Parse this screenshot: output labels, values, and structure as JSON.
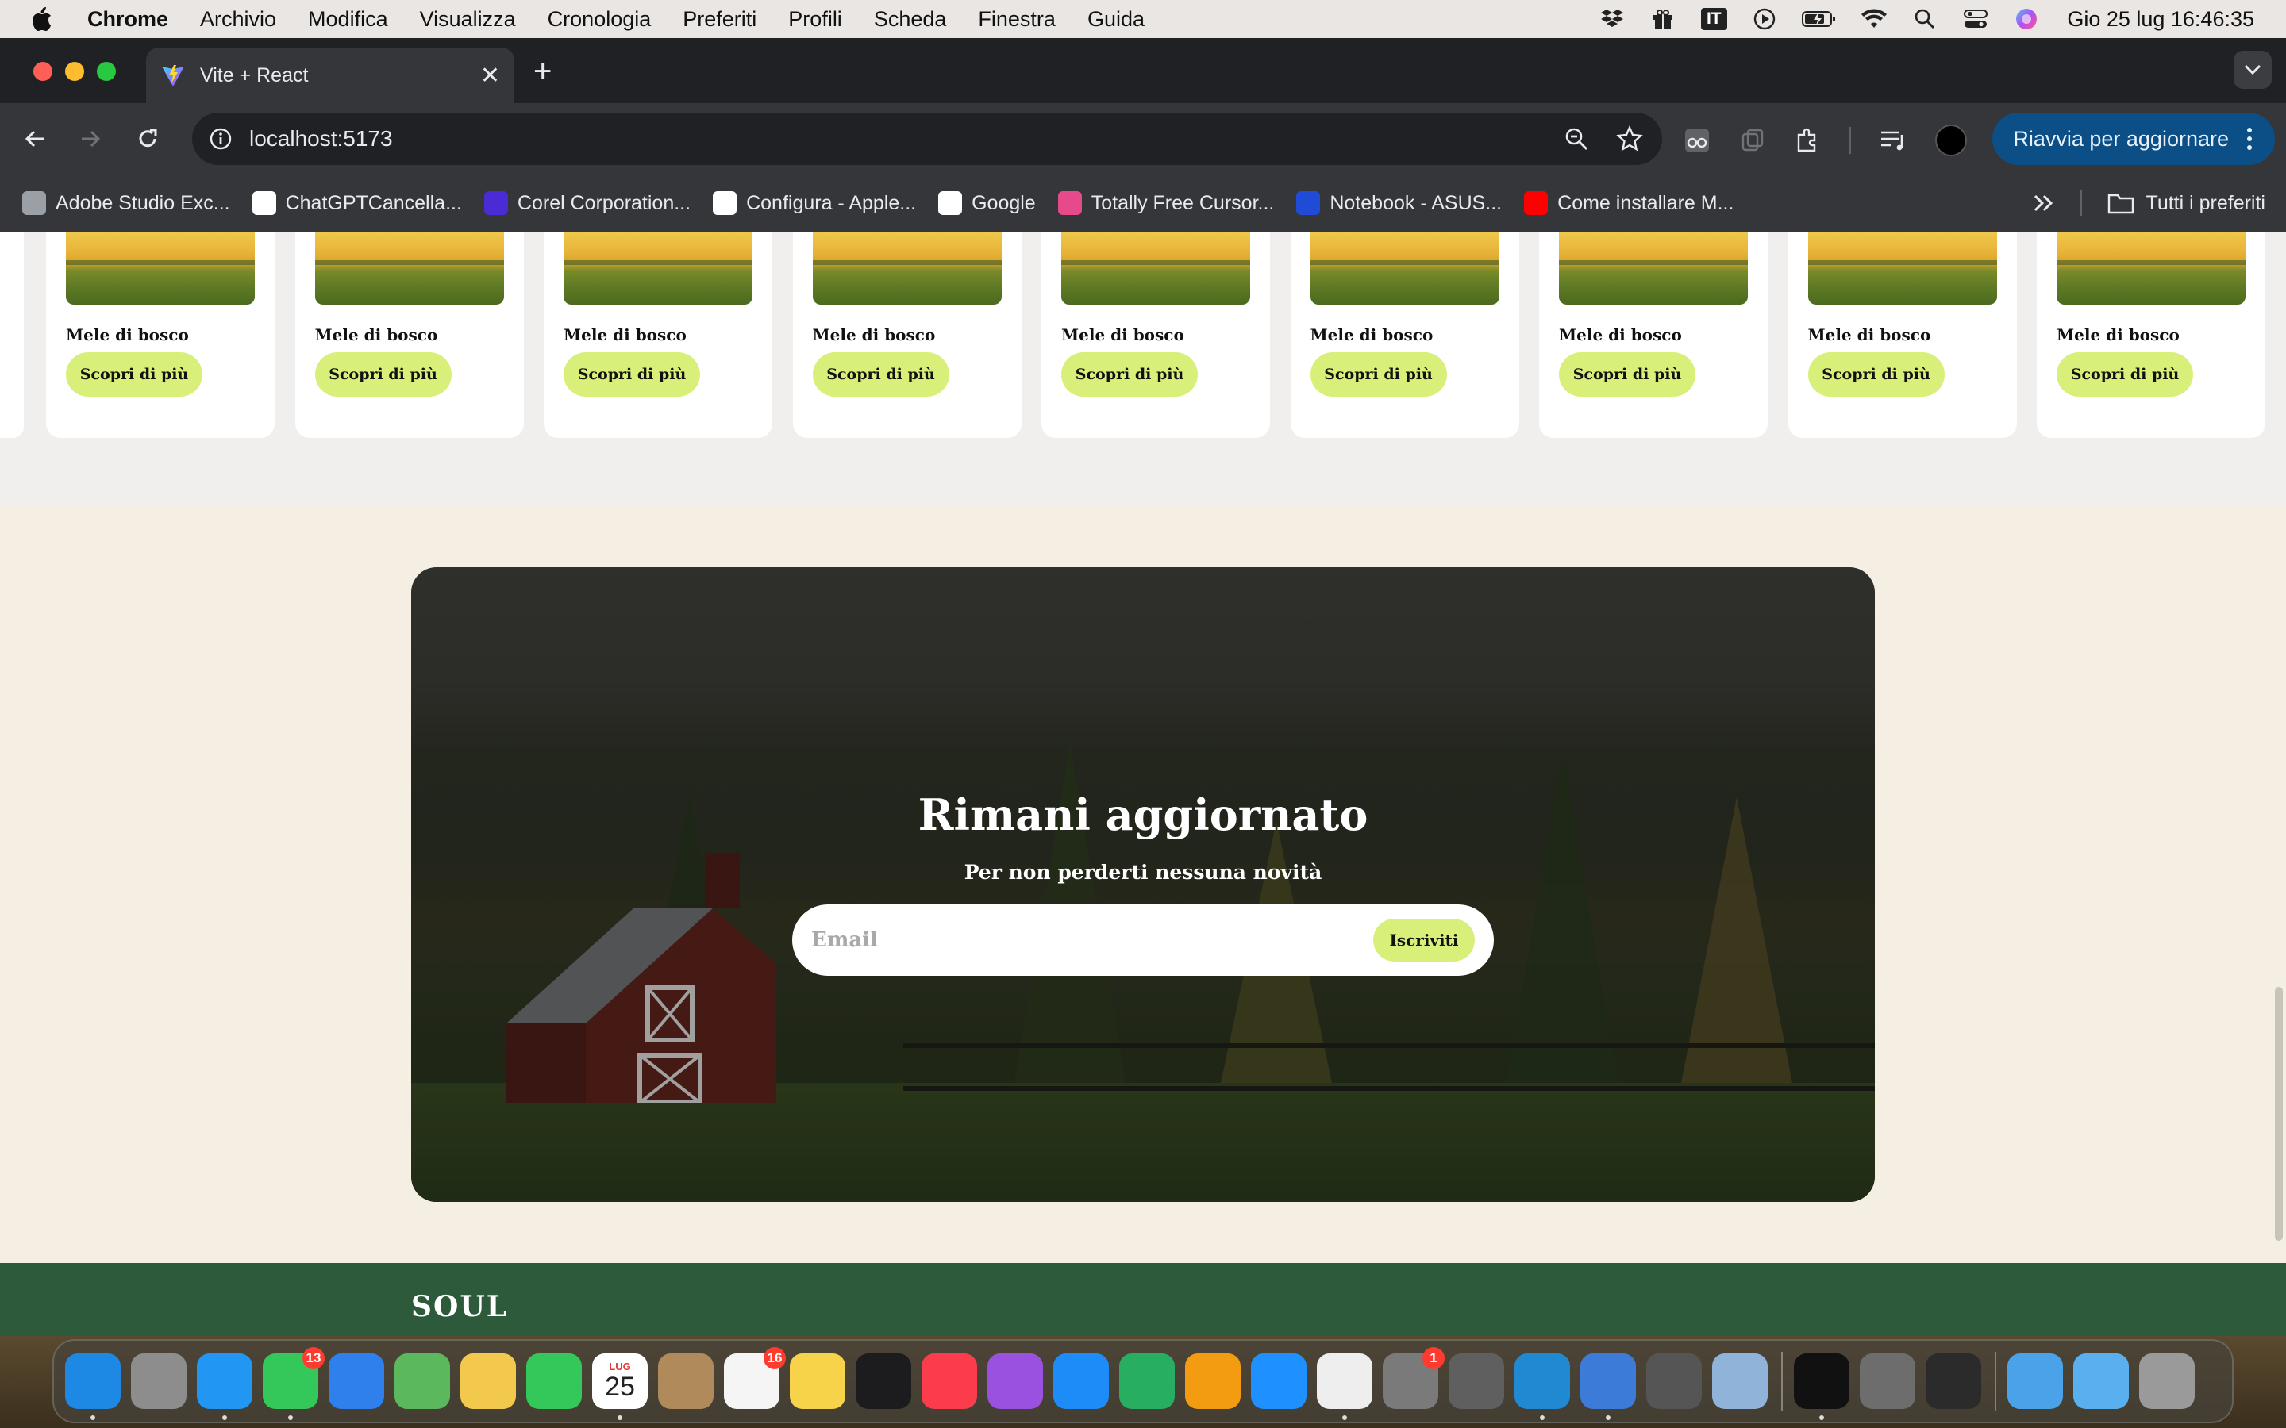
{
  "menubar": {
    "app": "Chrome",
    "items": [
      "Archivio",
      "Modifica",
      "Visualizza",
      "Cronologia",
      "Preferiti",
      "Profili",
      "Scheda",
      "Finestra",
      "Guida"
    ],
    "input_source": "IT",
    "clock": "Gio 25 lug  16:46:35"
  },
  "browser": {
    "tab_title": "Vite + React",
    "url": "localhost:5173",
    "update_button": "Riavvia per aggiornare",
    "bookmarks": [
      {
        "label": "Adobe Studio Exc...",
        "icon": "globe-icon",
        "color": "#9aa0a6"
      },
      {
        "label": "ChatGPTCancella...",
        "icon": "chatgpt-icon",
        "color": "#ffffff"
      },
      {
        "label": "Corel Corporation...",
        "icon": "corel-icon",
        "color": "#4b2bd6"
      },
      {
        "label": "Configura - Apple...",
        "icon": "apple-icon",
        "color": "#ffffff"
      },
      {
        "label": "Google",
        "icon": "google-icon",
        "color": "#ffffff"
      },
      {
        "label": "Totally Free Cursor...",
        "icon": "cursor-icon",
        "color": "#e64a8a"
      },
      {
        "label": "Notebook - ASUS...",
        "icon": "asus-icon",
        "color": "#1f4bd6"
      },
      {
        "label": "Come installare M...",
        "icon": "youtube-icon",
        "color": "#ff0000"
      }
    ],
    "all_bookmarks": "Tutti i preferiti"
  },
  "page": {
    "products": [
      {
        "name": "Mele di bosco",
        "cta": "Scopri di più"
      },
      {
        "name": "Mele di bosco",
        "cta": "Scopri di più"
      },
      {
        "name": "Mele di bosco",
        "cta": "Scopri di più"
      },
      {
        "name": "Mele di bosco",
        "cta": "Scopri di più"
      },
      {
        "name": "Mele di bosco",
        "cta": "Scopri di più"
      },
      {
        "name": "Mele di bosco",
        "cta": "Scopri di più"
      },
      {
        "name": "Mele di bosco",
        "cta": "Scopri di più"
      },
      {
        "name": "Mele di bosco",
        "cta": "Scopri di più"
      },
      {
        "name": "Mele di bosco",
        "cta": "Scopri di più"
      }
    ],
    "newsletter": {
      "title": "Rimani aggiornato",
      "subtitle": "Per non perderti nessuna novità",
      "email_placeholder": "Email",
      "submit": "Iscriviti"
    },
    "footer_logo": "SOUL"
  },
  "dock": {
    "calendar_month": "LUG",
    "calendar_day": "25",
    "apps": [
      {
        "name": "finder-icon",
        "color": "#1e88e5",
        "badge": ""
      },
      {
        "name": "launchpad-icon",
        "color": "#8d8d8d",
        "badge": ""
      },
      {
        "name": "safari-icon",
        "color": "#2196f3",
        "badge": ""
      },
      {
        "name": "messages-icon",
        "color": "#34c759",
        "badge": "13"
      },
      {
        "name": "mail-icon",
        "color": "#2f80ed",
        "badge": ""
      },
      {
        "name": "maps-icon",
        "color": "#5cb85c",
        "badge": ""
      },
      {
        "name": "photos-icon",
        "color": "#f2c94c",
        "badge": ""
      },
      {
        "name": "facetime-icon",
        "color": "#34c759",
        "badge": ""
      },
      {
        "name": "calendar-icon",
        "color": "#ffffff",
        "badge": ""
      },
      {
        "name": "contacts-icon",
        "color": "#b08a5a",
        "badge": ""
      },
      {
        "name": "reminders-icon",
        "color": "#f5f5f5",
        "badge": "16"
      },
      {
        "name": "notes-icon",
        "color": "#f7d34a",
        "badge": ""
      },
      {
        "name": "tv-icon",
        "color": "#1c1c1e",
        "badge": ""
      },
      {
        "name": "music-icon",
        "color": "#fa3c4c",
        "badge": ""
      },
      {
        "name": "podcasts-icon",
        "color": "#9b51e0",
        "badge": ""
      },
      {
        "name": "keynote-icon",
        "color": "#1d8cf8",
        "badge": ""
      },
      {
        "name": "numbers-icon",
        "color": "#27ae60",
        "badge": ""
      },
      {
        "name": "pages-icon",
        "color": "#f39c12",
        "badge": ""
      },
      {
        "name": "app-store-icon",
        "color": "#1e90ff",
        "badge": ""
      },
      {
        "name": "chrome-icon",
        "color": "#eeeeee",
        "badge": ""
      },
      {
        "name": "system-settings-icon",
        "color": "#7a7a7a",
        "badge": "1"
      },
      {
        "name": "screenshot-icon",
        "color": "#5f5f5f",
        "badge": ""
      },
      {
        "name": "vscode-icon",
        "color": "#1f8ad2",
        "badge": ""
      },
      {
        "name": "lw-icon",
        "color": "#3d7bd9",
        "badge": ""
      },
      {
        "name": "help-icon",
        "color": "#555555",
        "badge": ""
      },
      {
        "name": "preview-icon",
        "color": "#8fb3d9",
        "badge": ""
      },
      {
        "name": "terminal-icon",
        "color": "#111111",
        "badge": ""
      },
      {
        "name": "font-book-icon",
        "color": "#6d6d6d",
        "badge": ""
      },
      {
        "name": "voice-memos-icon",
        "color": "#2b2b2b",
        "badge": ""
      },
      {
        "name": "downloads-folder-icon",
        "color": "#4aa3e8",
        "badge": ""
      },
      {
        "name": "applications-folder-icon",
        "color": "#5ab0ee",
        "badge": ""
      },
      {
        "name": "trash-icon",
        "color": "#9a9a9a",
        "badge": ""
      }
    ]
  }
}
